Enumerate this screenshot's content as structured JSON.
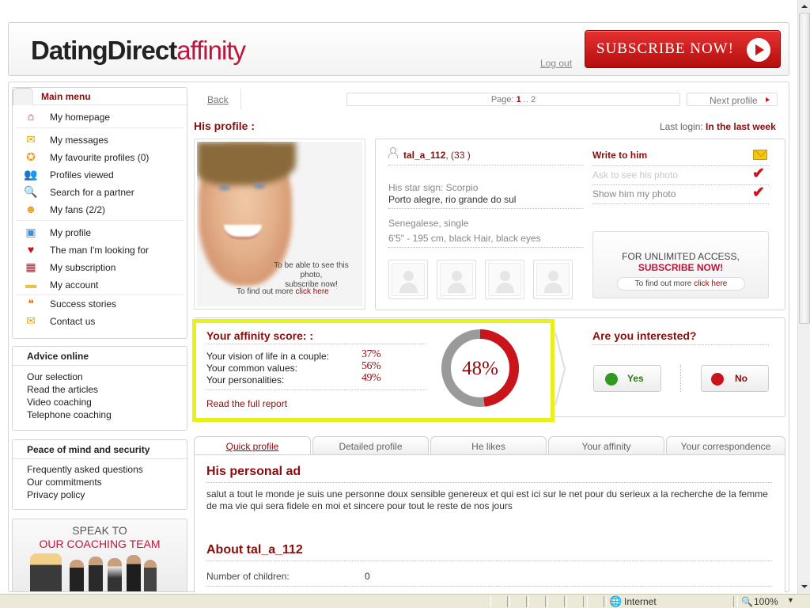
{
  "header": {
    "logo_main": "DatingDirect",
    "logo_accent": "affinity",
    "logout": "Log out",
    "subscribe": "SUBSCRIBE NOW!"
  },
  "menu": {
    "title": "Main menu",
    "items": [
      {
        "label": "My homepage",
        "icon": "home-icon"
      },
      {
        "label": "My messages",
        "icon": "envelope-icon"
      },
      {
        "label": "My favourite profiles (0)",
        "icon": "star-icon"
      },
      {
        "label": "Profiles viewed",
        "icon": "users-icon"
      },
      {
        "label": "Search for a partner",
        "icon": "magnifier-icon"
      },
      {
        "label": "My fans (2/2)",
        "icon": "fans-icon"
      },
      {
        "label": "My profile",
        "icon": "profile-card-icon"
      },
      {
        "label": "The man I'm looking for",
        "icon": "heart-user-icon"
      },
      {
        "label": "My subscription",
        "icon": "calendar-icon"
      },
      {
        "label": "My account",
        "icon": "folder-icon"
      },
      {
        "label": "Success stories",
        "icon": "chat-bubbles-icon"
      },
      {
        "label": "Contact us",
        "icon": "envelope-icon"
      }
    ]
  },
  "advice": {
    "title": "Advice online",
    "links": [
      "Our selection",
      "Read the articles",
      "Video coaching",
      "Telephone coaching"
    ]
  },
  "peace": {
    "title": "Peace of mind and security",
    "links": [
      "Frequently asked questions",
      "Our commitments",
      "Privacy policy"
    ]
  },
  "coach": {
    "line1": "SPEAK TO",
    "line2": "OUR COACHING TEAM"
  },
  "nav": {
    "back": "Back",
    "page_label": "Page:",
    "page_current": "1",
    "page_sep": "..",
    "page_other": "2",
    "next": "Next profile"
  },
  "profile": {
    "heading": "His profile :",
    "last_login_label": "Last login:",
    "last_login_value": "In the last week",
    "photo_msg1": "To be able to see this photo,",
    "photo_msg2": "subscribe now!",
    "photo_more": "To find out more",
    "photo_click": "click here",
    "username": "tal_a_112",
    "age": ", (33 )",
    "star_sign": "His star sign: Scorpio",
    "location": "Porto alegre, rio grande do sul",
    "status": "Senegalese, single",
    "physique": "6'5\" - 195 cm, black Hair, black eyes",
    "write": "Write to him",
    "ask_photo": "Ask to see his photo",
    "show_photo": "Show him my photo",
    "unlimited1": "FOR UNLIMITED ACCESS,",
    "unlimited2": "SUBSCRIBE NOW!",
    "unlimited_more": "To find out more",
    "unlimited_click": "click here"
  },
  "affinity": {
    "title": "Your affinity score: :",
    "rows": [
      {
        "label": "Your vision of life in a couple:",
        "value": "37%"
      },
      {
        "label": "Your common values:",
        "value": "56%"
      },
      {
        "label": "Your personalities:",
        "value": "49%"
      }
    ],
    "read_full": "Read the full report",
    "score": 48,
    "score_label": "48%",
    "interested": "Are you interested?",
    "yes": "Yes",
    "no": "No"
  },
  "tabs": [
    "Quick profile",
    "Detailed profile",
    "He likes",
    "Your affinity",
    "Your correspondence"
  ],
  "ad": {
    "heading": "His personal ad",
    "text": "salut a tout le monde je suis une personne doux sensible genereux et qui est ici sur le net pour du serieux a la recherche de la femme de ma vie qui sera fidele en moi et sincere pour tout le reste de nos jours"
  },
  "about": {
    "heading": "About tal_a_112",
    "children_label": "Number of children:",
    "children_value": "0"
  },
  "statusbar": {
    "zone": "Internet",
    "zoom": "100%"
  },
  "colors": {
    "brand": "#c0143c",
    "dark_red": "#8a0c0c",
    "highlight": "#eaf01a"
  }
}
